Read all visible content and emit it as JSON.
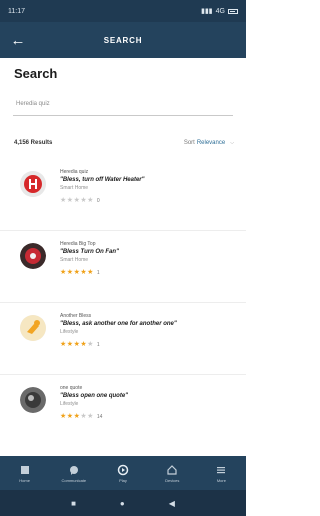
{
  "status_bar": {
    "time": "11:17",
    "right_text": "4G"
  },
  "app_bar": {
    "title": "SEARCH"
  },
  "search": {
    "heading": "Search",
    "query": "Heredia quiz"
  },
  "results": {
    "count_label": "4,156 Results",
    "sort_label": "Sort",
    "sort_value": "Relevance"
  },
  "items": [
    {
      "author": "Heredia quiz",
      "quote": "\"Bless, turn off Water Heater\"",
      "category": "Smart Home",
      "rating": 0,
      "rating_count": "0"
    },
    {
      "author": "Heredia Big Top",
      "quote": "\"Bless Turn On Fan\"",
      "category": "Smart Home",
      "rating": 5,
      "rating_count": "1"
    },
    {
      "author": "Another Bless",
      "quote": "\"Bless, ask another one for another one\"",
      "category": "Lifestyle",
      "rating": 4,
      "rating_count": "1"
    },
    {
      "author": "one quote",
      "quote": "\"Bless open one quote\"",
      "category": "Lifestyle",
      "rating": 3,
      "rating_count": "14"
    }
  ],
  "bottom_nav": [
    {
      "label": "Home",
      "icon": "home-icon"
    },
    {
      "label": "Communicate",
      "icon": "chat-icon"
    },
    {
      "label": "Play",
      "icon": "play-icon"
    },
    {
      "label": "Devices",
      "icon": "devices-icon"
    },
    {
      "label": "More",
      "icon": "menu-icon"
    }
  ],
  "colors": {
    "app_bar": "#24435d",
    "accent": "#2f6f97",
    "star": "#f0a21a"
  }
}
